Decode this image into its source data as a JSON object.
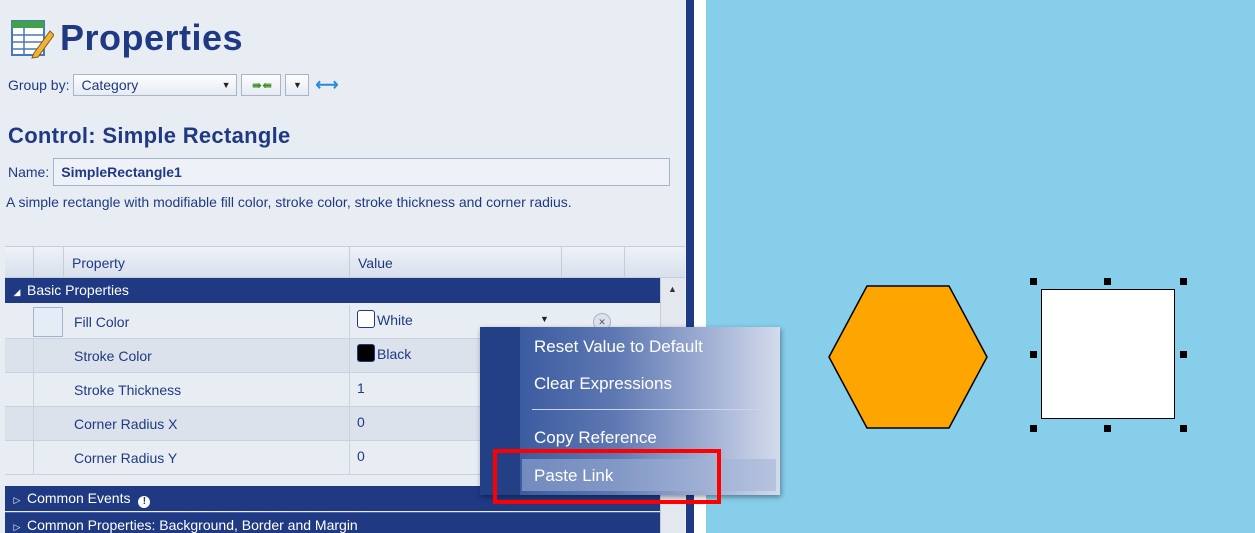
{
  "panel": {
    "title": "Properties",
    "group_by_label": "Group by:",
    "group_by_value": "Category",
    "control_title": "Control: Simple Rectangle",
    "name_label": "Name:",
    "name_value": "SimpleRectangle1",
    "description": "A simple rectangle with modifiable fill color, stroke color, stroke thickness and corner radius."
  },
  "grid": {
    "headers": [
      "Property",
      "Value"
    ],
    "categories": {
      "basic": "Basic Properties",
      "events": "Common Events",
      "common": "Common Properties: Background, Border and Margin"
    },
    "rows": [
      {
        "name": "Fill Color",
        "value": "White",
        "swatch": "#ffffff"
      },
      {
        "name": "Stroke Color",
        "value": "Black",
        "swatch": "#000000"
      },
      {
        "name": "Stroke Thickness",
        "value": "1"
      },
      {
        "name": "Corner Radius X",
        "value": "0"
      },
      {
        "name": "Corner Radius Y",
        "value": "0"
      }
    ]
  },
  "context_menu": {
    "items": [
      "Reset Value to Default",
      "Clear Expressions",
      "Copy Reference",
      "Paste Link"
    ],
    "highlighted": "Paste Link"
  },
  "canvas": {
    "background": "#87ceeb",
    "hexagon_fill": "#ffa500",
    "rectangle_fill": "#ffffff"
  },
  "colors": {
    "accent": "#1f3a82",
    "highlight_box": "#ff0000"
  }
}
